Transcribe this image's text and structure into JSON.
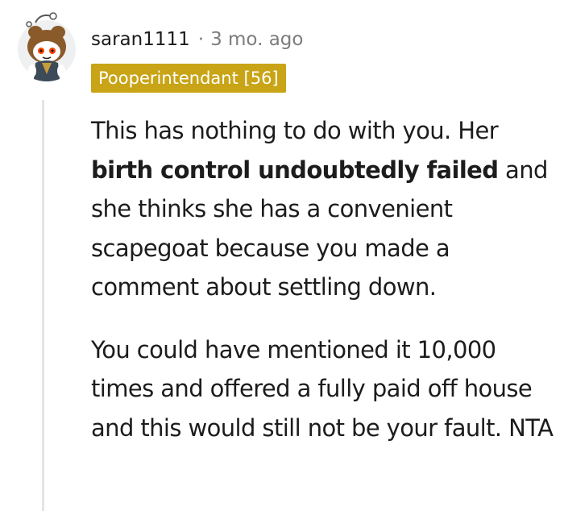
{
  "comment": {
    "username": "saran1111",
    "separator": "·",
    "timestamp": "3 mo. ago",
    "flair": "Pooperintendant [56]",
    "paragraph1": {
      "before": "This has nothing to do with you. Her ",
      "bold": "birth control undoubtedly failed",
      "after": " and she thinks she has a convenient scapegoat because you made a comment about settling down."
    },
    "paragraph2": "You could have mentioned it 10,000 times and offered a fully paid off house and this would still not be your fault. NTA"
  },
  "colors": {
    "flair_background": "#c8a416",
    "flair_text": "#ffffff",
    "meta_gray": "#7c7c7c",
    "text": "#1c1c1c",
    "thread_line": "#e3e6e8"
  },
  "icons": {
    "avatar": "snoo-avatar-icon"
  }
}
